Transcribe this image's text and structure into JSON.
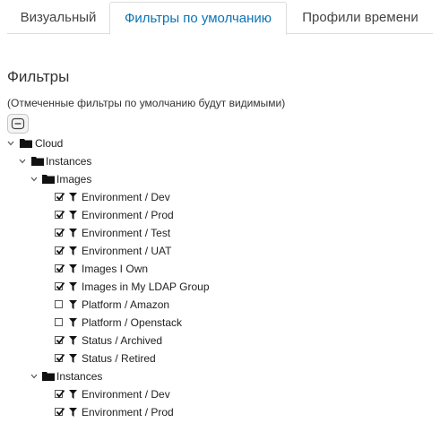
{
  "tabs": [
    {
      "label": "Визуальный",
      "active": false
    },
    {
      "label": "Фильтры по умолчанию",
      "active": true
    },
    {
      "label": "Профили времени",
      "active": false
    }
  ],
  "section": {
    "title": "Фильтры",
    "hint": "(Отмеченные фильтры по умолчанию будут видимыми)"
  },
  "tree": {
    "cloud": "Cloud",
    "instances": "Instances",
    "images": "Images",
    "image_filters": [
      {
        "label": "Environment / Dev",
        "checked": true
      },
      {
        "label": "Environment / Prod",
        "checked": true
      },
      {
        "label": "Environment / Test",
        "checked": true
      },
      {
        "label": "Environment / UAT",
        "checked": true
      },
      {
        "label": "Images I Own",
        "checked": true
      },
      {
        "label": "Images in My LDAP Group",
        "checked": true
      },
      {
        "label": "Platform / Amazon",
        "checked": false
      },
      {
        "label": "Platform / Openstack",
        "checked": false
      },
      {
        "label": "Status / Archived",
        "checked": true
      },
      {
        "label": "Status / Retired",
        "checked": true
      }
    ],
    "instances2": "Instances",
    "instance_filters": [
      {
        "label": "Environment / Dev",
        "checked": true
      },
      {
        "label": "Environment / Prod",
        "checked": true
      }
    ]
  },
  "colors": {
    "accent": "#0b73b5",
    "border": "#dddddd"
  }
}
